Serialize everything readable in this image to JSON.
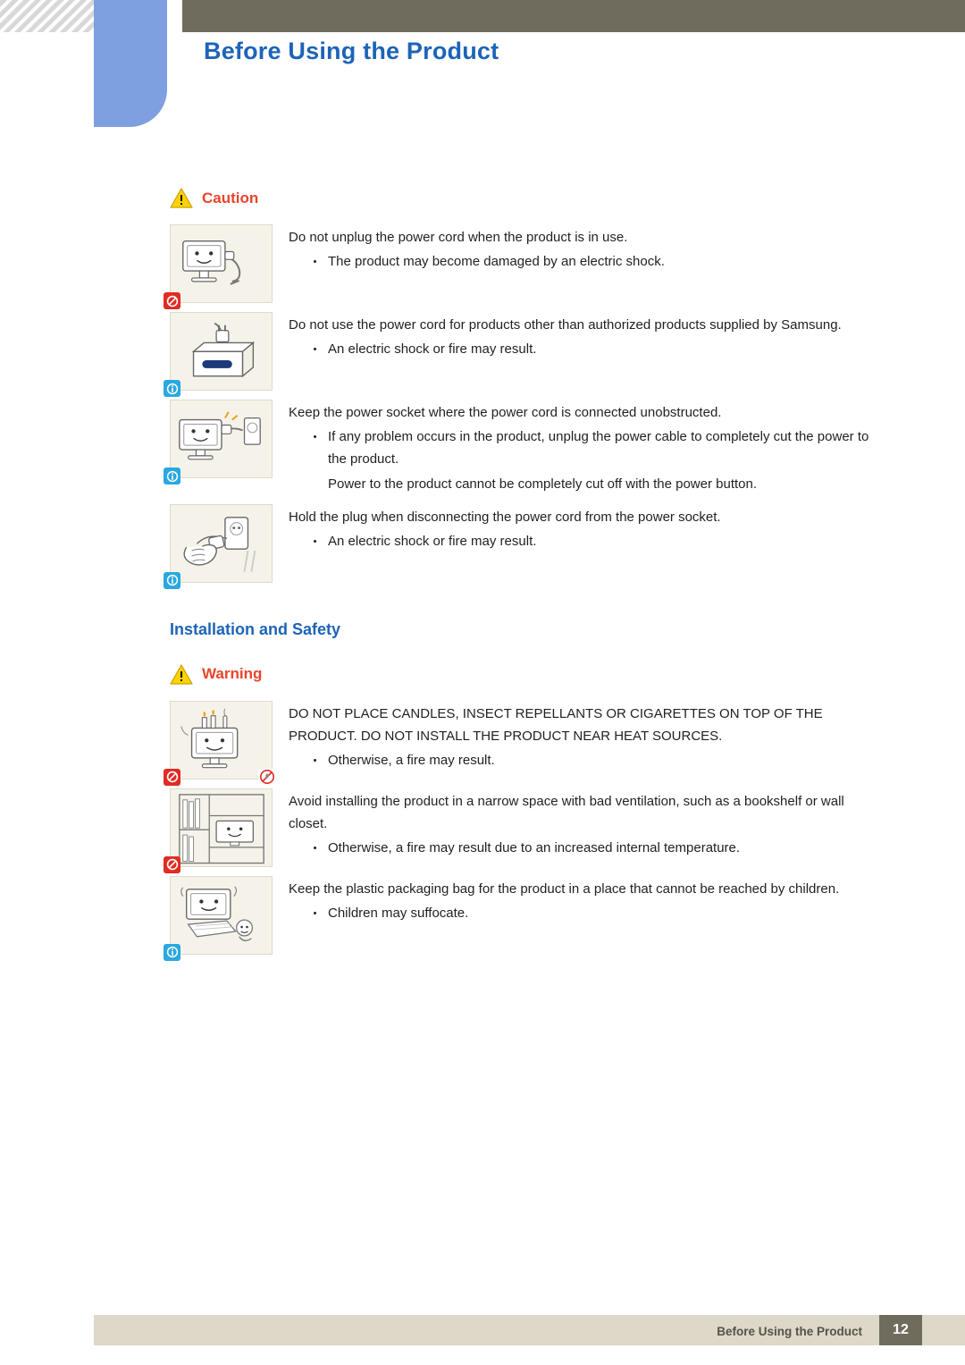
{
  "header": {
    "title": "Before Using the Product"
  },
  "caution": {
    "label": "Caution",
    "icon": "warning-triangle-icon",
    "items": [
      {
        "figure": "monitor-unplug-cord-figure",
        "badges": [
          "prohibited-icon"
        ],
        "lines": [
          {
            "type": "paragraph",
            "text": "Do not unplug the power cord when the product is in use."
          },
          {
            "type": "bullet",
            "text": "The product may become damaged by an electric shock."
          }
        ]
      },
      {
        "figure": "power-cord-samsung-box-figure",
        "badges": [
          "mandatory-icon"
        ],
        "lines": [
          {
            "type": "paragraph",
            "text": "Do not use the power cord for products other than authorized products supplied by Samsung."
          },
          {
            "type": "bullet",
            "text": "An electric shock or fire may result."
          }
        ]
      },
      {
        "figure": "monitor-power-socket-figure",
        "badges": [
          "mandatory-icon"
        ],
        "lines": [
          {
            "type": "paragraph",
            "text": "Keep the power socket where the power cord is connected unobstructed."
          },
          {
            "type": "bullet",
            "text": "If any problem occurs in the product, unplug the power cable to completely cut the power to the product."
          },
          {
            "type": "continuation",
            "text": "Power to the product cannot be completely cut off with the power button."
          }
        ]
      },
      {
        "figure": "hand-holding-plug-figure",
        "badges": [
          "mandatory-icon"
        ],
        "lines": [
          {
            "type": "paragraph",
            "text": "Hold the plug when disconnecting the power cord from the power socket."
          },
          {
            "type": "bullet",
            "text": "An electric shock or fire may result."
          }
        ]
      }
    ]
  },
  "section": {
    "title": "Installation and Safety"
  },
  "warning": {
    "label": "Warning",
    "icon": "warning-triangle-icon",
    "items": [
      {
        "figure": "candles-on-monitor-figure",
        "badges": [
          "prohibited-icon",
          "no-fire-icon"
        ],
        "lines": [
          {
            "type": "paragraph",
            "text": "DO NOT PLACE CANDLES, INSECT REPELLANTS OR CIGARETTES ON TOP OF THE PRODUCT. DO NOT INSTALL THE PRODUCT NEAR HEAT SOURCES."
          },
          {
            "type": "bullet",
            "text": "Otherwise, a fire may result."
          }
        ]
      },
      {
        "figure": "monitor-in-bookshelf-figure",
        "badges": [
          "prohibited-icon"
        ],
        "lines": [
          {
            "type": "paragraph",
            "text": "Avoid installing the product in a narrow space with bad ventilation, such as a bookshelf or wall closet."
          },
          {
            "type": "bullet",
            "text": "Otherwise, a fire may result due to an increased internal temperature."
          }
        ]
      },
      {
        "figure": "plastic-bag-child-figure",
        "badges": [
          "mandatory-icon"
        ],
        "lines": [
          {
            "type": "paragraph",
            "text": "Keep the plastic packaging bag for the product in a place that cannot be reached by children."
          },
          {
            "type": "bullet",
            "text": "Children may suffocate."
          }
        ]
      }
    ]
  },
  "footer": {
    "text": "Before Using the Product",
    "page": "12"
  },
  "colors": {
    "header_band": "#6f6c5e",
    "blue_tab": "#7e9fe0",
    "title_blue": "#1d64b8",
    "alert_red": "#e8442a",
    "footer_band": "#ddd8c7",
    "figure_bg": "#f5f3e9"
  }
}
